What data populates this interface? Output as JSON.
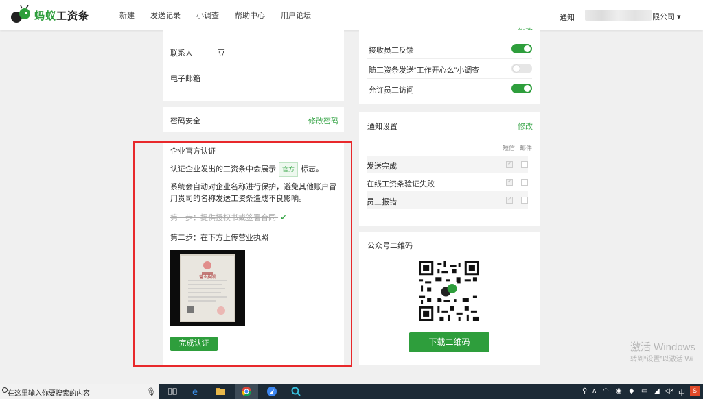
{
  "brand": {
    "logo_text_green": "蚂蚁",
    "logo_text_black": "工资条"
  },
  "nav": {
    "items": [
      "新建",
      "发送记录",
      "小调查",
      "帮助中心",
      "用户论坛"
    ]
  },
  "header": {
    "notice": "通知",
    "company_suffix": "限公司 ▾"
  },
  "contact": {
    "contact_label": "联系人",
    "contact_value": "豆",
    "email_label": "电子邮箱"
  },
  "security": {
    "label": "密码安全",
    "action": "修改密码"
  },
  "cert": {
    "title": "企业官方认证",
    "line1_pre": "认证企业发出的工资条中会展示",
    "official_tag": "官方",
    "line1_post": "标志。",
    "line2": "系统会自动对企业名称进行保护，避免其他账户冒用贵司的名称发送工资条造成不良影响。",
    "step1": "第一步：提供授权书或签署合同",
    "step2": "第二步：在下方上传营业执照",
    "license_heading": "营业执照",
    "complete_button": "完成认证"
  },
  "settings": {
    "rows": [
      {
        "label": "接收员工反馈",
        "on": true
      },
      {
        "label": "随工资条发送“工作开心么”小调查",
        "on": false
      },
      {
        "label": "允许员工访问",
        "on": true
      }
    ],
    "top_action": "修改"
  },
  "notify": {
    "title": "通知设置",
    "edit": "修改",
    "col_sms": "短信",
    "col_mail": "邮件",
    "rows": [
      {
        "label": "发送完成",
        "sms": true,
        "mail": false
      },
      {
        "label": "在线工资条验证失败",
        "sms": true,
        "mail": false
      },
      {
        "label": "员工报错",
        "sms": true,
        "mail": false
      }
    ]
  },
  "qr": {
    "title": "公众号二维码",
    "download": "下载二维码"
  },
  "watermark": {
    "line1": "激活 Windows",
    "line2": "转到“设置”以激活 Wi"
  },
  "taskbar": {
    "search_placeholder": "在这里输入你要搜索的内容",
    "ime": "中"
  },
  "colors": {
    "accent": "#2e9e3c",
    "highlight_box": "#e8282b"
  }
}
